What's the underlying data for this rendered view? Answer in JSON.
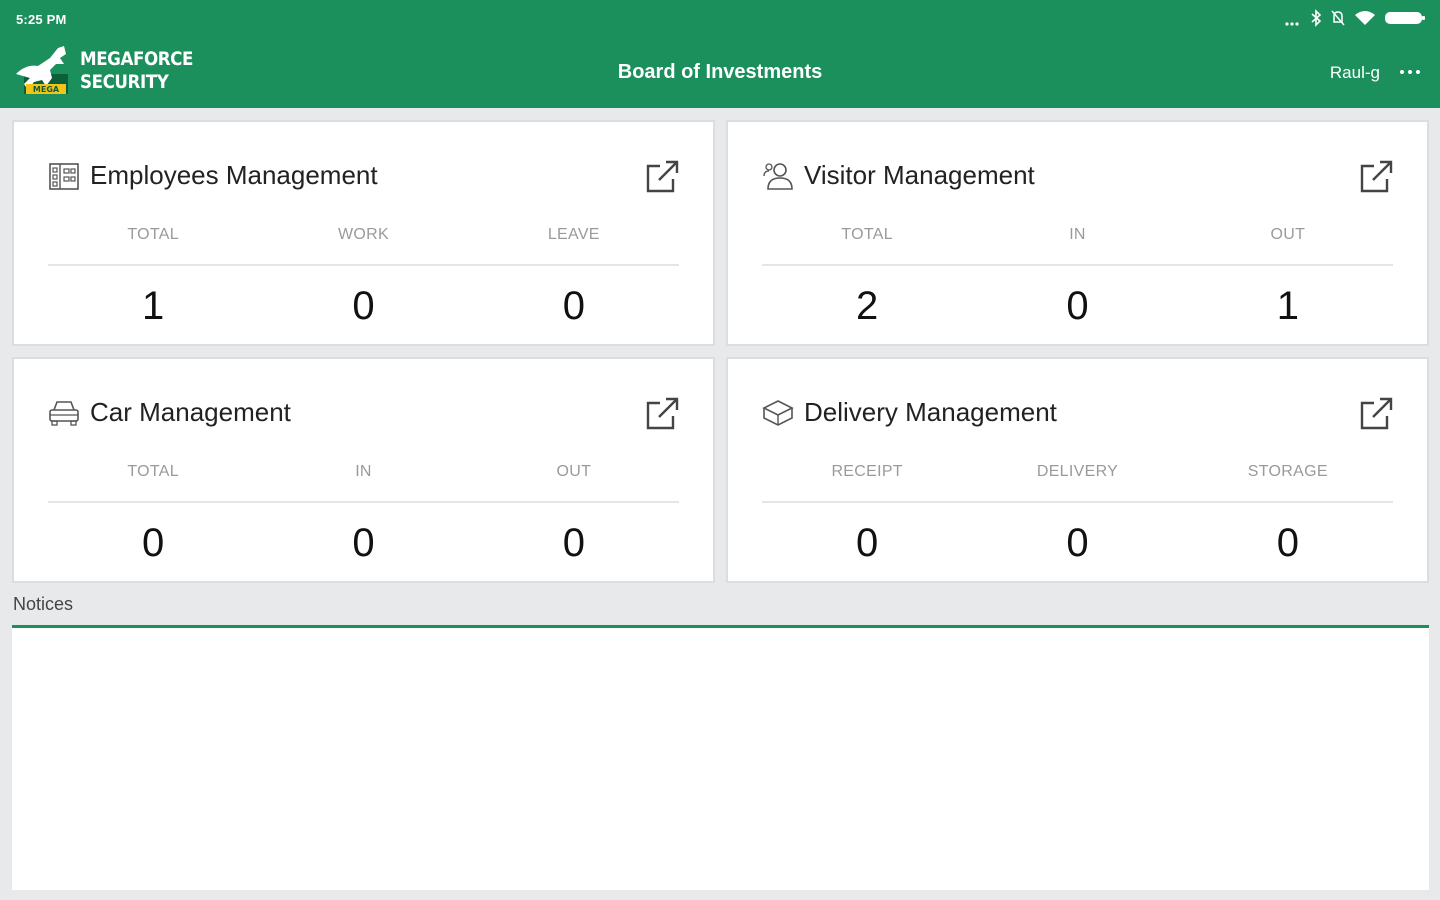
{
  "status": {
    "time": "5:25 PM",
    "icons": [
      "signal-dots-icon",
      "bluetooth-icon",
      "mute-icon",
      "wifi-icon",
      "battery-icon"
    ]
  },
  "header": {
    "logo_line1": "MEGAFORCE",
    "logo_line2": "SECURITY",
    "title": "Board of Investments",
    "user": "Raul-g",
    "more_icon": "more-horizontal-icon"
  },
  "colors": {
    "primary": "#1b8f5c",
    "background": "#e8e9eb"
  },
  "cards": [
    {
      "title": "Employees Management",
      "icon": "building-icon",
      "columns": [
        "TOTAL",
        "WORK",
        "LEAVE"
      ],
      "values": [
        "1",
        "0",
        "0"
      ]
    },
    {
      "title": "Visitor Management",
      "icon": "visitor-icon",
      "columns": [
        "TOTAL",
        "IN",
        "OUT"
      ],
      "values": [
        "2",
        "0",
        "1"
      ]
    },
    {
      "title": "Car Management",
      "icon": "car-icon",
      "columns": [
        "TOTAL",
        "IN",
        "OUT"
      ],
      "values": [
        "0",
        "0",
        "0"
      ]
    },
    {
      "title": "Delivery Management",
      "icon": "package-icon",
      "columns": [
        "RECEIPT",
        "DELIVERY",
        "STORAGE"
      ],
      "values": [
        "0",
        "0",
        "0"
      ]
    }
  ],
  "notices": {
    "label": "Notices"
  }
}
